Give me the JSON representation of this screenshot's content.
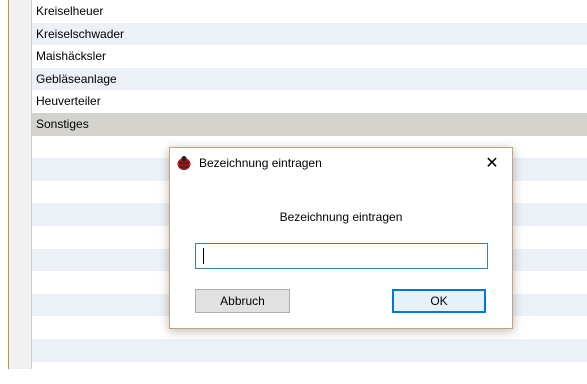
{
  "list": {
    "items": [
      {
        "label": "Kreiselheuer"
      },
      {
        "label": "Kreiselschwader"
      },
      {
        "label": "Maishäcksler"
      },
      {
        "label": "Gebläseanlage"
      },
      {
        "label": "Heuverteiler"
      },
      {
        "label": "Sonstiges",
        "selected": true
      }
    ]
  },
  "dialog": {
    "title": "Bezeichnung eintragen",
    "prompt": "Bezeichnung eintragen",
    "input_value": "",
    "cancel_label": "Abbruch",
    "ok_label": "OK",
    "close_glyph": "✕"
  },
  "colors": {
    "accent": "#0078d7",
    "row_alt": "#ecf1f8",
    "row_selected": "#d4d2cc"
  },
  "icons": {
    "app": "ladybug-icon",
    "close": "close-icon"
  }
}
